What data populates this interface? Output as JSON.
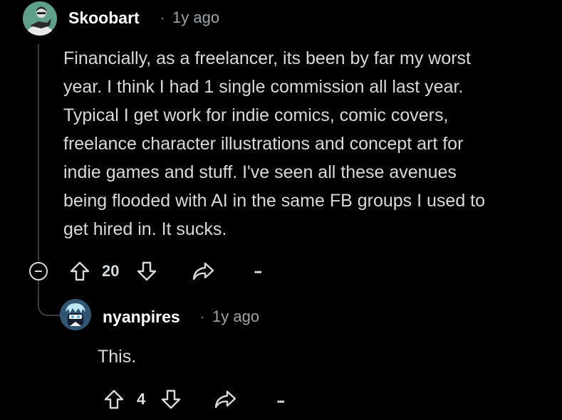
{
  "comment": {
    "author": "Skoobart",
    "separator": "·",
    "time": "1y ago",
    "body_lines": [
      "Financially, as a freelancer, its been by far my worst",
      "year. I think I had 1 single commission all last year.",
      "Typical I get work for indie comics, comic covers,",
      "freelance character illustrations and concept art for",
      "indie games and stuff. I've seen all these avenues",
      "being flooded with AI in the same FB groups I used to",
      "get hired in. It sucks."
    ],
    "score": "20",
    "more_label": "•••"
  },
  "reply": {
    "author": "nyanpires",
    "separator": "·",
    "time": "1y ago",
    "body": "This.",
    "score": "4",
    "more_label": "•••"
  },
  "icons": {
    "collapse": "collapse-minus-icon",
    "upvote": "arrow-up-icon",
    "downvote": "arrow-down-icon",
    "share": "share-icon",
    "more": "more-dots-icon"
  },
  "colors": {
    "background": "#000000",
    "text": "#d7dadc",
    "muted": "#9ea3a8",
    "thread_line": "#3a3f44",
    "avatar1_bg": "#5fa08a",
    "avatar2_bg": "#3f6a8c"
  }
}
